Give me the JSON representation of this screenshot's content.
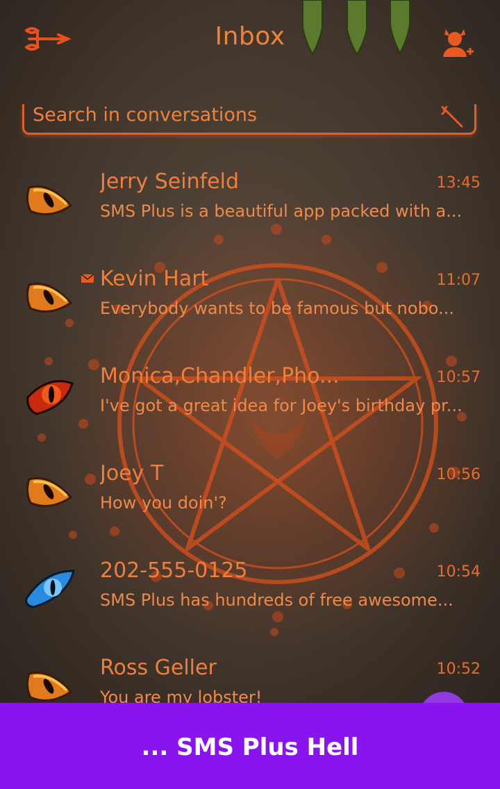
{
  "header": {
    "title": "Inbox"
  },
  "search": {
    "placeholder": "Search in conversations"
  },
  "conversations": [
    {
      "name": "Jerry Seinfeld",
      "time": "13:45",
      "preview": "SMS Plus is a beautiful app packed with a...",
      "avatar": "orange-eye-icon",
      "unread": false
    },
    {
      "name": "Kevin Hart",
      "time": "11:07",
      "preview": "Everybody wants to be famous but nobo...",
      "avatar": "orange-eye-icon",
      "unread": true
    },
    {
      "name": "Monica,Chandler,Pho...",
      "time": "10:57",
      "preview": "I've got a great idea for Joey's birthday pr...",
      "avatar": "red-eye-icon",
      "unread": false
    },
    {
      "name": "Joey T",
      "time": "10:56",
      "preview": "How you doin'?",
      "avatar": "orange-eye-icon",
      "unread": false
    },
    {
      "name": "202-555-0125",
      "time": "10:54",
      "preview": "SMS Plus has hundreds of free awesome...",
      "avatar": "blue-eye-icon",
      "unread": false
    },
    {
      "name": "Ross Geller",
      "time": "10:52",
      "preview": " You are my lobster!",
      "avatar": "orange-eye-icon",
      "unread": false
    }
  ],
  "banner": {
    "text": "... SMS Plus Hell"
  },
  "colors": {
    "accent": "#f0823c",
    "banner": "#8a14ee",
    "background": "#44382e"
  }
}
